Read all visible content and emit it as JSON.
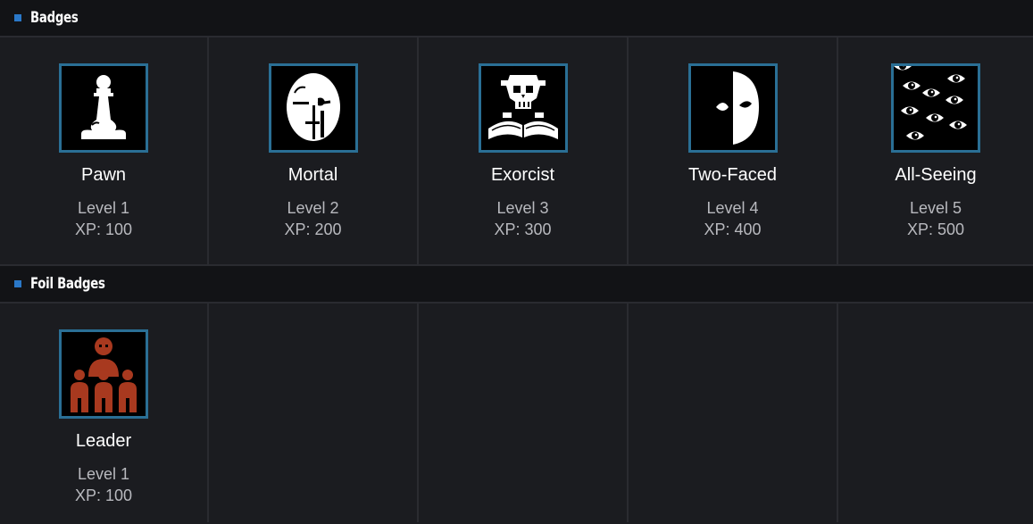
{
  "sections": [
    {
      "title": "Badges",
      "badges": [
        {
          "name": "Pawn",
          "level": "Level 1",
          "xp": "XP: 100",
          "icon": "pawn-icon"
        },
        {
          "name": "Mortal",
          "level": "Level 2",
          "xp": "XP: 200",
          "icon": "mask-icon"
        },
        {
          "name": "Exorcist",
          "level": "Level 3",
          "xp": "XP: 300",
          "icon": "skull-book-icon"
        },
        {
          "name": "Two-Faced",
          "level": "Level 4",
          "xp": "XP: 400",
          "icon": "half-mask-icon"
        },
        {
          "name": "All-Seeing",
          "level": "Level 5",
          "xp": "XP: 500",
          "icon": "many-eyes-icon"
        }
      ]
    },
    {
      "title": "Foil Badges",
      "badges": [
        {
          "name": "Leader",
          "level": "Level 1",
          "xp": "XP: 100",
          "icon": "crowd-leader-icon"
        }
      ]
    }
  ],
  "colors": {
    "accent": "#2a78c8",
    "icon_border": "#2a6f95",
    "foil_icon": "#a8391f",
    "background": "#1b1c20",
    "header_background": "#121316"
  }
}
